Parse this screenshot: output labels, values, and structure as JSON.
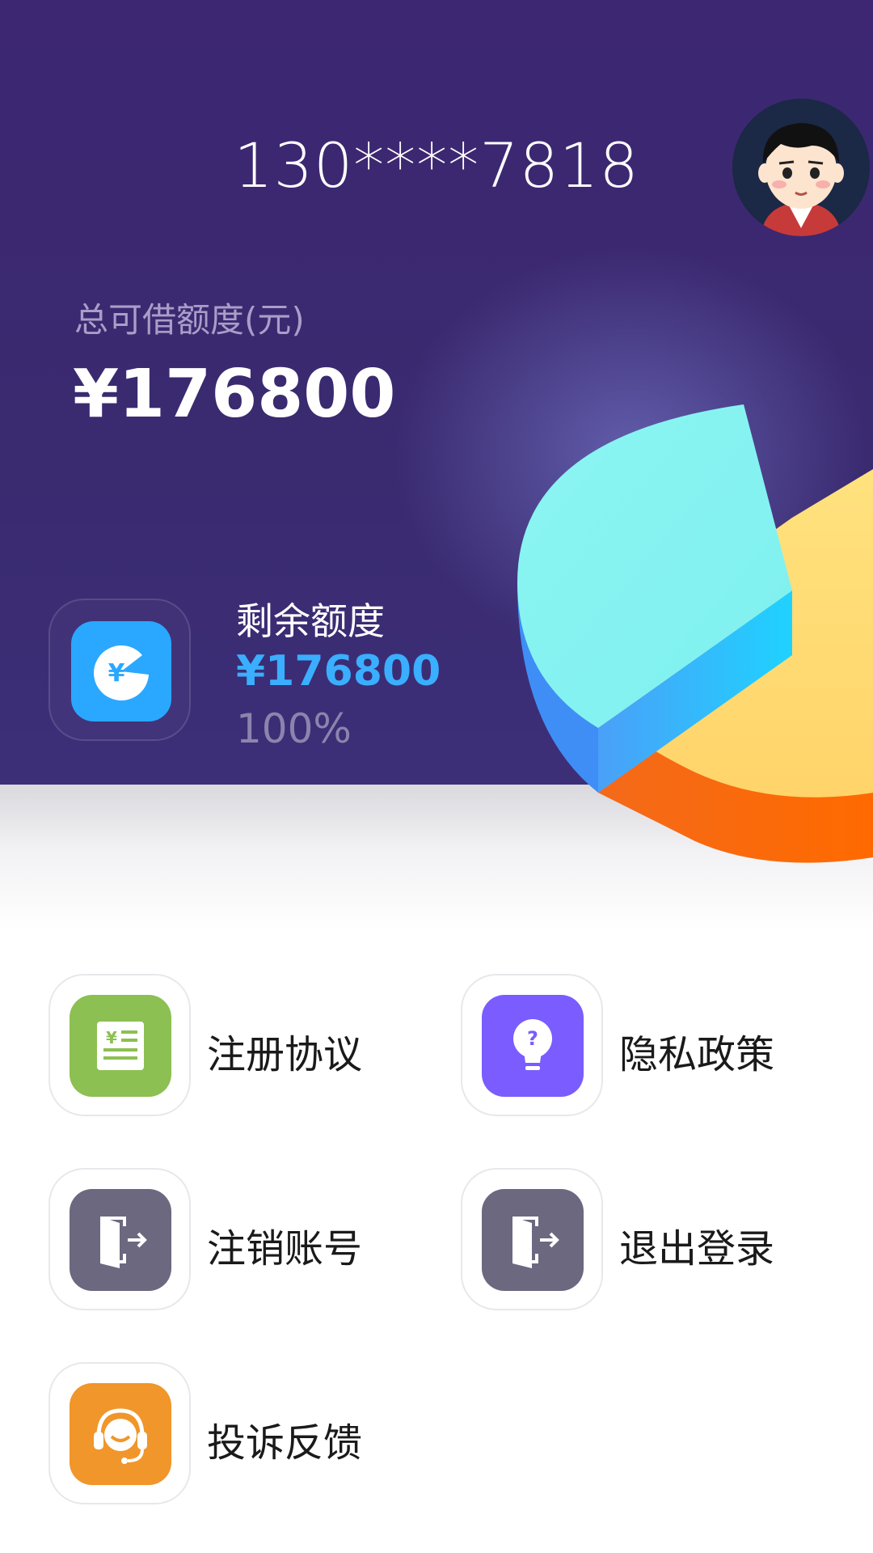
{
  "header": {
    "phone": "130****7818"
  },
  "credit": {
    "total_label": "总可借额度(元)",
    "total_value": "¥176800"
  },
  "remaining": {
    "label": "剩余额度",
    "value": "¥176800",
    "percent": "100%",
    "percent_value": 100,
    "icon": "yen-pie-icon"
  },
  "menu": [
    {
      "label": "注册协议",
      "icon": "document-yen-icon",
      "color": "#8cc052"
    },
    {
      "label": "隐私政策",
      "icon": "lightbulb-question-icon",
      "color": "#7a5cff"
    },
    {
      "label": "注销账号",
      "icon": "exit-door-icon",
      "color": "#6b6880"
    },
    {
      "label": "退出登录",
      "icon": "exit-door-icon",
      "color": "#6b6880"
    },
    {
      "label": "投诉反馈",
      "icon": "headset-icon",
      "color": "#f0962a"
    }
  ],
  "colors": {
    "hero_bg": "#3d2772",
    "accent_blue": "#3aaeff"
  }
}
